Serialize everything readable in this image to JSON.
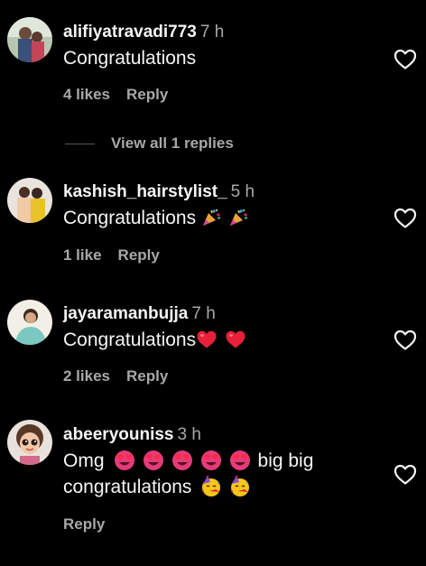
{
  "comments": [
    {
      "username": "alifiyatravadi773",
      "time": "7 h",
      "text": "Congratulations",
      "likes": "4 likes",
      "reply": "Reply",
      "view_replies": "View all 1 replies"
    },
    {
      "username": "kashish_hairstylist_",
      "time": "5 h",
      "text": "Congratulations",
      "emoji_names": [
        "party-popper-emoji",
        "party-popper-emoji"
      ],
      "likes": "1 like",
      "reply": "Reply"
    },
    {
      "username": "jayaramanbujja",
      "time": "7 h",
      "text": "Congratulations",
      "emoji_names": [
        "red-heart-emoji",
        "red-heart-emoji"
      ],
      "likes": "2 likes",
      "reply": "Reply"
    },
    {
      "username": "abeeryouniss",
      "time": "3 h",
      "text_before": "Omg",
      "text_after": "big big",
      "text_line2": "congratulations",
      "emoji_names": [
        "heart-eyes-emoji",
        "heart-eyes-emoji",
        "heart-eyes-emoji",
        "heart-eyes-emoji",
        "heart-eyes-emoji",
        "partying-face-emoji",
        "partying-face-emoji"
      ],
      "reply": "Reply"
    }
  ],
  "icons": {
    "like": "heart-outline-icon"
  },
  "colors": {
    "background": "#000000",
    "primary_text": "#f5f5f5",
    "secondary_text": "#a8a8a8",
    "heart_red": "#e8203a",
    "heart_eyes_pink": "#e43b7a"
  }
}
